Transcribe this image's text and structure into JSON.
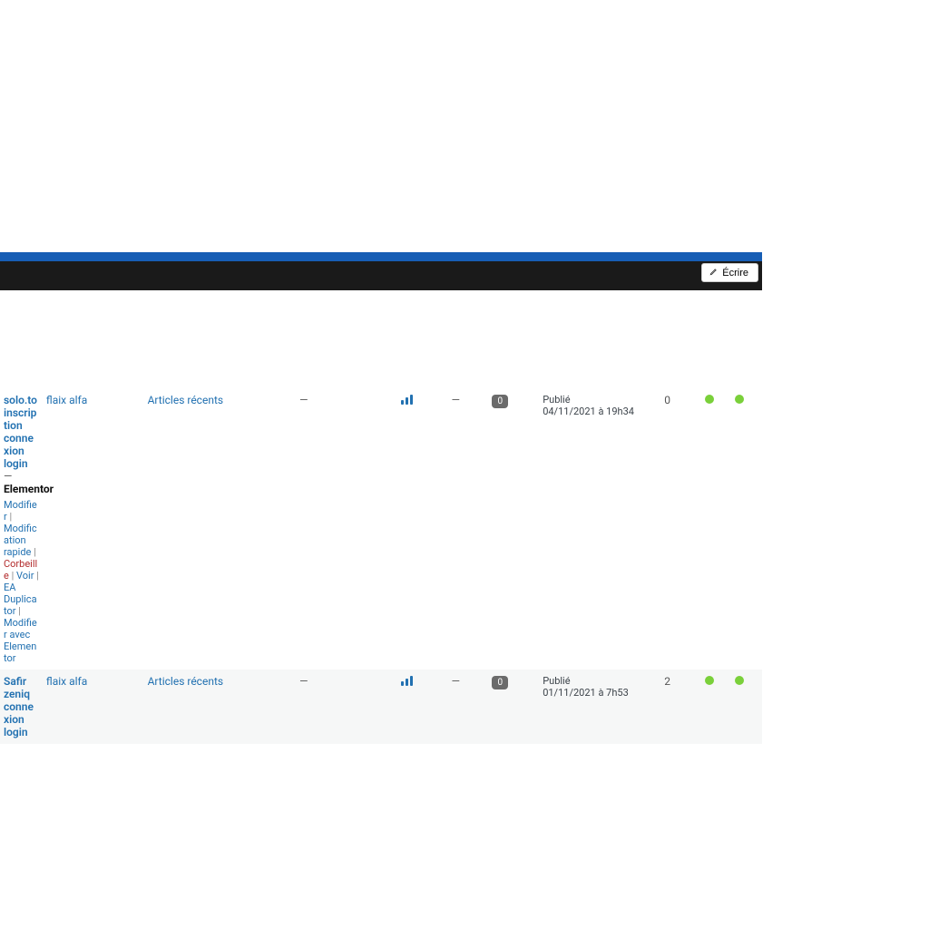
{
  "header": {
    "write_label": "Écrire"
  },
  "row_actions": {
    "modifier": "Modifier",
    "modification_rapide": "Modification rapide",
    "corbeille": "Corbeille",
    "voir": "Voir",
    "ea_duplicator": "EA Duplicator",
    "modifier_avec_elementor": "Modifier avec Elementor"
  },
  "elementor_tag": "Elementor",
  "rows": [
    {
      "title": "solo.to inscription connexion login",
      "author": "flaix alfa",
      "category": "Articles récents",
      "tags": "—",
      "dash": "—",
      "comments": "0",
      "date_status": "Publié",
      "date_value": "04/11/2021 à 19h34",
      "count": "0"
    },
    {
      "title": "Safir zeniq connexion login",
      "author": "flaix alfa",
      "category": "Articles récents",
      "tags": "—",
      "dash": "—",
      "comments": "0",
      "date_status": "Publié",
      "date_value": "01/11/2021 à 7h53",
      "count": "2"
    }
  ]
}
